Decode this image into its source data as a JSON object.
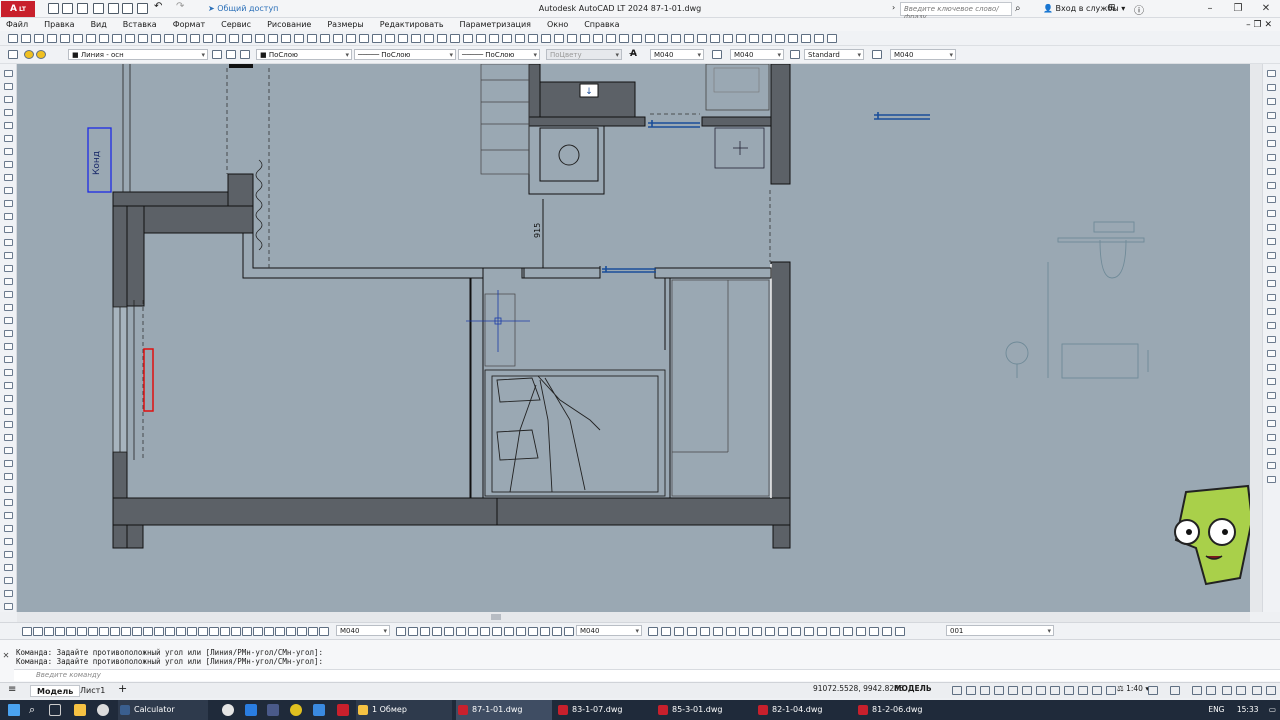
{
  "window": {
    "title": "Autodesk AutoCAD LT 2024    87-1-01.dwg",
    "logo_text": "A",
    "logo_badge": "LT",
    "share_label": "Общий доступ",
    "search_placeholder": "Введите ключевое слово/фразу",
    "login_label": "Вход в службы"
  },
  "menu": [
    "Файл",
    "Правка",
    "Вид",
    "Вставка",
    "Формат",
    "Сервис",
    "Рисование",
    "Размеры",
    "Редактировать",
    "Параметризация",
    "Окно",
    "Справка"
  ],
  "properties_bar": {
    "layer": "Линия - осн",
    "color": "ПоСлою",
    "linetype": "ПоСлою",
    "lineweight": "ПоСлою",
    "plotstyle": "ПоЦвету",
    "dimstyle_1": "М040",
    "dimstyle_2": "М040",
    "text_style": "Standard",
    "table_style": "М040"
  },
  "drawing": {
    "room_label": "Конд",
    "dimension_label": "915"
  },
  "style_bar": {
    "dimstyle_a": "М040",
    "dimstyle_b": "М040",
    "layer_filter": "001"
  },
  "command_history": [
    "Команда: Задайте противоположный угол или [Линия/РМн-угол/СМн-угол]:",
    "Команда: Задайте противоположный угол или [Линия/РМн-угол/СМн-угол]:"
  ],
  "command_placeholder": "Введите команду",
  "layout_tabs": [
    "Модель",
    "Лист1"
  ],
  "status": {
    "coordinates": "91072.5528, 9942.8286",
    "space": "МОДЕЛЬ",
    "scale": "1:40"
  },
  "taskbar": {
    "apps": [
      "Calculator",
      "1 Обмер",
      "87-1-01.dwg",
      "83-1-07.dwg",
      "85-3-01.dwg",
      "82-1-04.dwg",
      "81-2-06.dwg"
    ],
    "language": "ENG",
    "time": "15:33"
  },
  "colors": {
    "canvas": "#9aa8b3",
    "wall": "#5c6167",
    "accent_blue": "#1a4e9a",
    "accent_red": "#e01010",
    "autocad_red": "#c8202c"
  }
}
